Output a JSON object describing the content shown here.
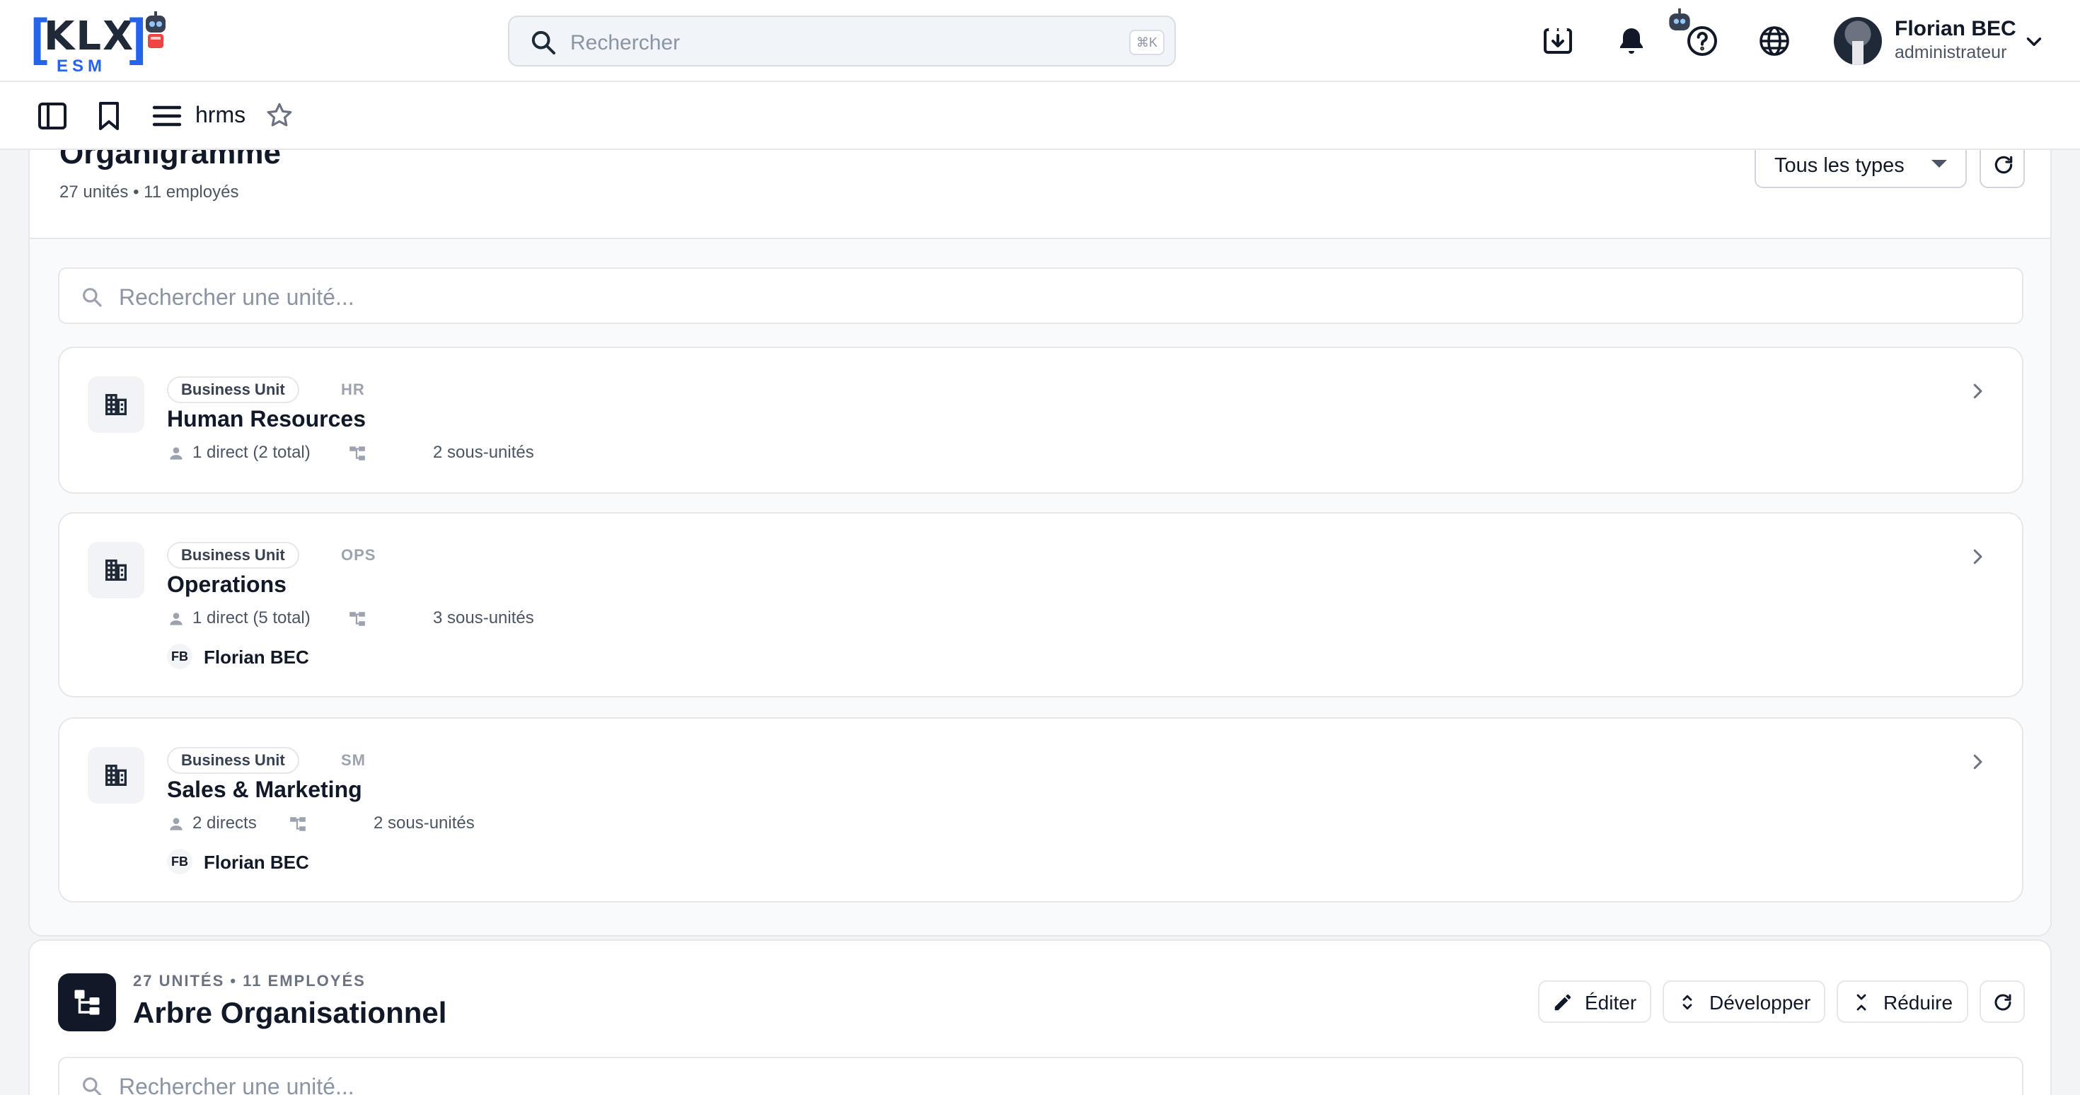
{
  "brand": {
    "logo_text": "KLX",
    "logo_sub": "ESM",
    "bracket_open": "[",
    "bracket_close": "]"
  },
  "search": {
    "placeholder": "Rechercher",
    "shortcut": "⌘K"
  },
  "user": {
    "name": "Florian BEC",
    "role": "administrateur"
  },
  "toolbar": {
    "module": "hrms"
  },
  "orgchart": {
    "title": "Organigramme",
    "subtitle": "27 unités • 11 employés",
    "type_filter": "Tous les types",
    "search_placeholder": "Rechercher une unité...",
    "units": [
      {
        "badge": "Business Unit",
        "code": "HR",
        "name": "Human Resources",
        "direct": "1 direct (2 total)",
        "subunits": "2 sous-unités",
        "manager_initials": "",
        "manager_name": ""
      },
      {
        "badge": "Business Unit",
        "code": "OPS",
        "name": "Operations",
        "direct": "1 direct (5 total)",
        "subunits": "3 sous-unités",
        "manager_initials": "FB",
        "manager_name": "Florian BEC"
      },
      {
        "badge": "Business Unit",
        "code": "SM",
        "name": "Sales & Marketing",
        "direct": "2 directs",
        "subunits": "2 sous-unités",
        "manager_initials": "FB",
        "manager_name": "Florian BEC"
      }
    ]
  },
  "tree": {
    "caption": "27 UNITÉS • 11 EMPLOYÉS",
    "title": "Arbre Organisationnel",
    "edit_label": "Éditer",
    "expand_label": "Développer",
    "collapse_label": "Réduire",
    "search_placeholder": "Rechercher une unité..."
  },
  "colors": {
    "brand_blue": "#2563eb",
    "text_dark": "#111827",
    "border": "#e5e7eb"
  }
}
